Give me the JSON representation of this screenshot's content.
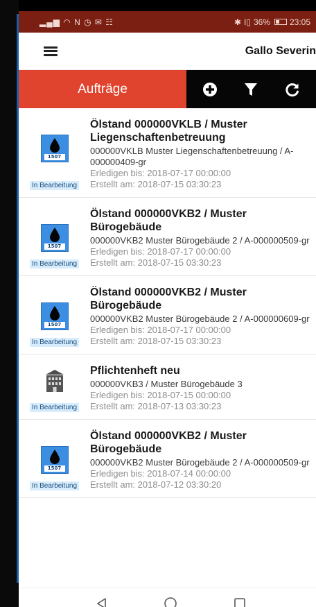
{
  "status_bar": {
    "left_icons": "▂▄▆ ◠ N ◷ ✉ ☷",
    "bluetooth": "✱",
    "vibrate": "I▯",
    "battery_text": "36%",
    "time": "23:05"
  },
  "app_bar": {
    "menu_icon": "hamburger-icon",
    "user_name": "Gallo Severin"
  },
  "toolbar": {
    "title": "Aufträge",
    "add_icon": "plus-circle-icon",
    "filter_icon": "filter-icon",
    "refresh_icon": "refresh-icon"
  },
  "colors": {
    "status_bar": "#7a1f12",
    "accent": "#e0442f",
    "toolbar_dark": "#060606",
    "badge_bg": "#d7ecfc",
    "oil_icon_blue": "#3c8ee2"
  },
  "orders": [
    {
      "icon": "oil-drop-icon",
      "icon_code": "1507",
      "title": "Ölstand 000000VKLB / Muster Liegenschaftenbetreuung",
      "description": "000000VKLB Muster Liegenschaftenbetreuung / A-000000409-gr",
      "due": "Erledigen bis: 2018-07-17 00:00:00",
      "created": "Erstellt am: 2018-07-15 03:30:23",
      "status": "In Bearbeitung"
    },
    {
      "icon": "oil-drop-icon",
      "icon_code": "1507",
      "title": "Ölstand 000000VKB2 / Muster Bürogebäude",
      "description": "000000VKB2 Muster Bürogebäude 2 / A-000000509-gr",
      "due": "Erledigen bis: 2018-07-17 00:00:00",
      "created": "Erstellt am: 2018-07-15 03:30:23",
      "status": "In Bearbeitung"
    },
    {
      "icon": "oil-drop-icon",
      "icon_code": "1507",
      "title": "Ölstand 000000VKB2 / Muster Bürogebäude",
      "description": "000000VKB2 Muster Bürogebäude 2 / A-000000609-gr",
      "due": "Erledigen bis: 2018-07-17 00:00:00",
      "created": "Erstellt am: 2018-07-15 03:30:23",
      "status": "In Bearbeitung"
    },
    {
      "icon": "building-icon",
      "icon_code": "",
      "title": "Pflichtenheft neu",
      "description": "000000VKB3 / Muster Bürogebäude 3",
      "due": "Erledigen bis: 2018-07-15 00:00:00",
      "created": "Erstellt am: 2018-07-13 03:30:23",
      "status": "In Bearbeitung"
    },
    {
      "icon": "oil-drop-icon",
      "icon_code": "1507",
      "title": "Ölstand 000000VKB2 / Muster Bürogebäude",
      "description": "000000VKB2 Muster Bürogebäude 2 / A-000000509-gr",
      "due": "Erledigen bis: 2018-07-14 00:00:00",
      "created": "Erstellt am: 2018-07-12 03:30:20",
      "status": "In Bearbeitung"
    }
  ],
  "nav_bar": {
    "back_icon": "back-triangle-icon",
    "home_icon": "home-circle-icon",
    "recents_icon": "recents-square-icon"
  }
}
